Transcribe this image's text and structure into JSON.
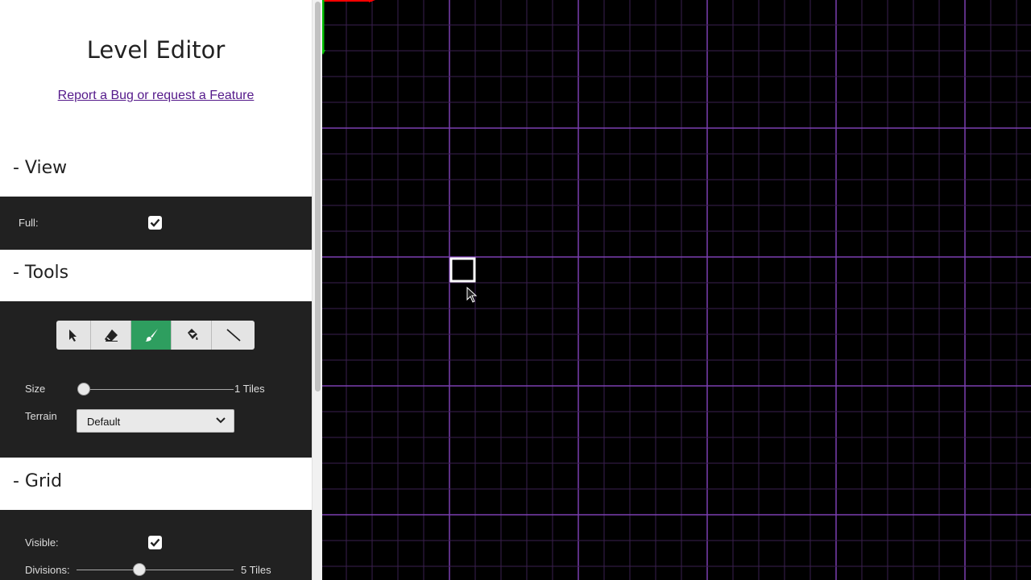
{
  "sidebar": {
    "title": "Level Editor",
    "bug_link": "Report a Bug or request a Feature",
    "view": {
      "heading": "- View",
      "full_label": "Full:",
      "full_checked": true
    },
    "tools": {
      "heading": "- Tools",
      "buttons": [
        {
          "icon": "cursor-icon",
          "active": false
        },
        {
          "icon": "eraser-icon",
          "active": false
        },
        {
          "icon": "brush-icon",
          "active": true
        },
        {
          "icon": "fill-bucket-icon",
          "active": false
        },
        {
          "icon": "line-icon",
          "active": false
        }
      ],
      "size_label": "Size",
      "size_value": "1 Tiles",
      "size_level": 0,
      "terrain_label": "Terrain",
      "terrain_value": "Default"
    },
    "grid": {
      "heading": "- Grid",
      "visible_label": "Visible:",
      "visible_checked": true,
      "divisions_label": "Divisions:",
      "divisions_value": "5 Tiles",
      "divisions_level": 0.4
    }
  },
  "colors": {
    "grid_minor": "#3a1f4f",
    "grid_major": "#7a3fb0",
    "active_tool": "#2e9e5f",
    "axis_x": "#ff0000",
    "axis_y": "#00c000"
  }
}
